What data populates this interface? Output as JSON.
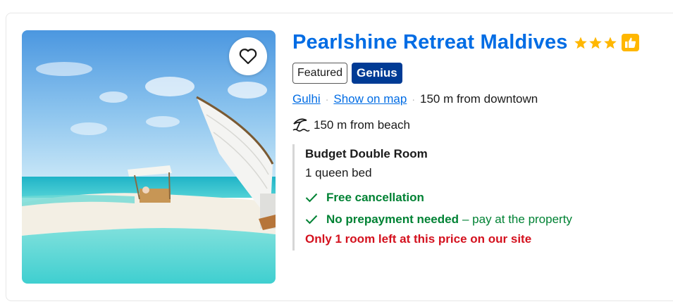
{
  "hotel": {
    "name": "Pearlshine Retreat Maldives",
    "star_count": 3,
    "star_icon": "star-icon",
    "thumbs_icon": "thumbs-up-icon",
    "favorite_icon": "heart-outline-icon",
    "photo": "maldives-beach-photo"
  },
  "badges": {
    "featured": "Featured",
    "genius": "Genius"
  },
  "location": {
    "area": "Gulhi",
    "map_link": "Show on map",
    "distance_downtown": "150 m from downtown",
    "beach_icon": "beach-umbrella-icon",
    "distance_beach": "150 m from beach"
  },
  "room": {
    "name": "Budget Double Room",
    "bed": "1 queen bed",
    "free_cancellation": "Free cancellation",
    "no_prepayment": "No prepayment needed",
    "pay_note": "– pay at the property",
    "scarcity": "Only 1 room left at this price on our site"
  },
  "colors": {
    "brand_blue": "#006ce4",
    "genius_blue": "#003b95",
    "star_yellow": "#ffb700",
    "success_green": "#008234",
    "urgent_red": "#d4111e"
  }
}
